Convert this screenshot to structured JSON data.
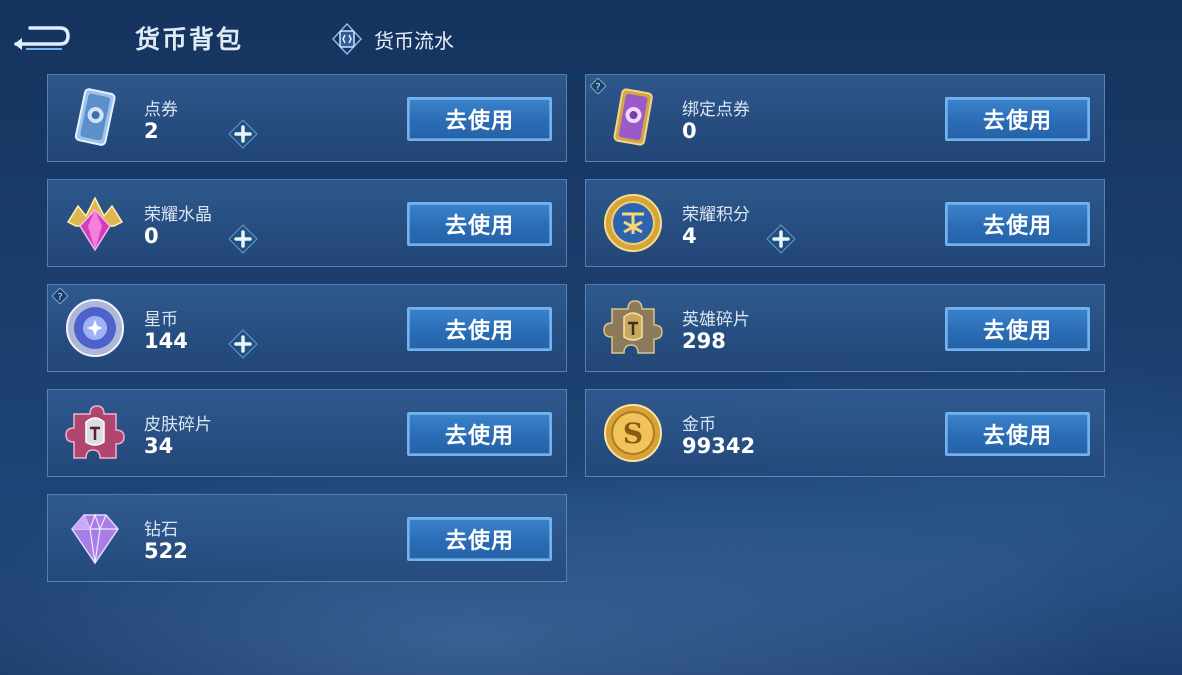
{
  "header": {
    "title": "货币背包",
    "flow_label": "货币流水"
  },
  "currencies": [
    {
      "name": "点券",
      "amount": "2",
      "button": "去使用",
      "icon": "ticket-blue-icon"
    },
    {
      "name": "绑定点券",
      "amount": "0",
      "button": "去使用",
      "icon": "ticket-purple-icon"
    },
    {
      "name": "荣耀水晶",
      "amount": "0",
      "button": "去使用",
      "icon": "glory-crystal-icon"
    },
    {
      "name": "荣耀积分",
      "amount": "4",
      "button": "去使用",
      "icon": "glory-points-icon"
    },
    {
      "name": "星币",
      "amount": "144",
      "button": "去使用",
      "icon": "star-coin-icon"
    },
    {
      "name": "英雄碎片",
      "amount": "298",
      "button": "去使用",
      "icon": "hero-fragment-icon"
    },
    {
      "name": "皮肤碎片",
      "amount": "34",
      "button": "去使用",
      "icon": "skin-fragment-icon"
    },
    {
      "name": "金币",
      "amount": "99342",
      "button": "去使用",
      "icon": "gold-coin-icon"
    },
    {
      "name": "钻石",
      "amount": "522",
      "button": "去使用",
      "icon": "diamond-icon"
    }
  ],
  "colors": {
    "button": "#2a6cb5",
    "button_border": "#6fb3f0",
    "card_bg": "#2c5a92",
    "background": "#1b3e6c"
  }
}
